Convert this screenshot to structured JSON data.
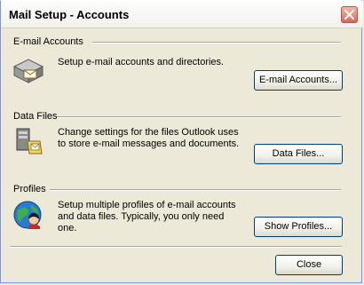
{
  "window": {
    "title": "Mail Setup - Accounts"
  },
  "sections": {
    "email": {
      "label": "E-mail Accounts",
      "description": "Setup e-mail accounts and directories.",
      "button": "E-mail Accounts..."
    },
    "datafiles": {
      "label": "Data Files",
      "description_line1": "Change settings for the files Outlook uses",
      "description_line2": "to store e-mail messages and documents.",
      "button": "Data Files..."
    },
    "profiles": {
      "label": "Profiles",
      "description_line1": "Setup multiple profiles of e-mail accounts",
      "description_line2": "and data files. Typically, you only need",
      "description_line3": "one.",
      "button": "Show Profiles..."
    }
  },
  "footer": {
    "close_label": "Close"
  },
  "icons": {
    "close": "close-x-icon",
    "email": "mail-tray-icon",
    "datafiles": "data-files-icon",
    "profiles": "profile-globe-icon"
  },
  "colors": {
    "dialog_bg": "#ece9d8",
    "close_button": "#d36b59",
    "button_border": "#003c74"
  }
}
